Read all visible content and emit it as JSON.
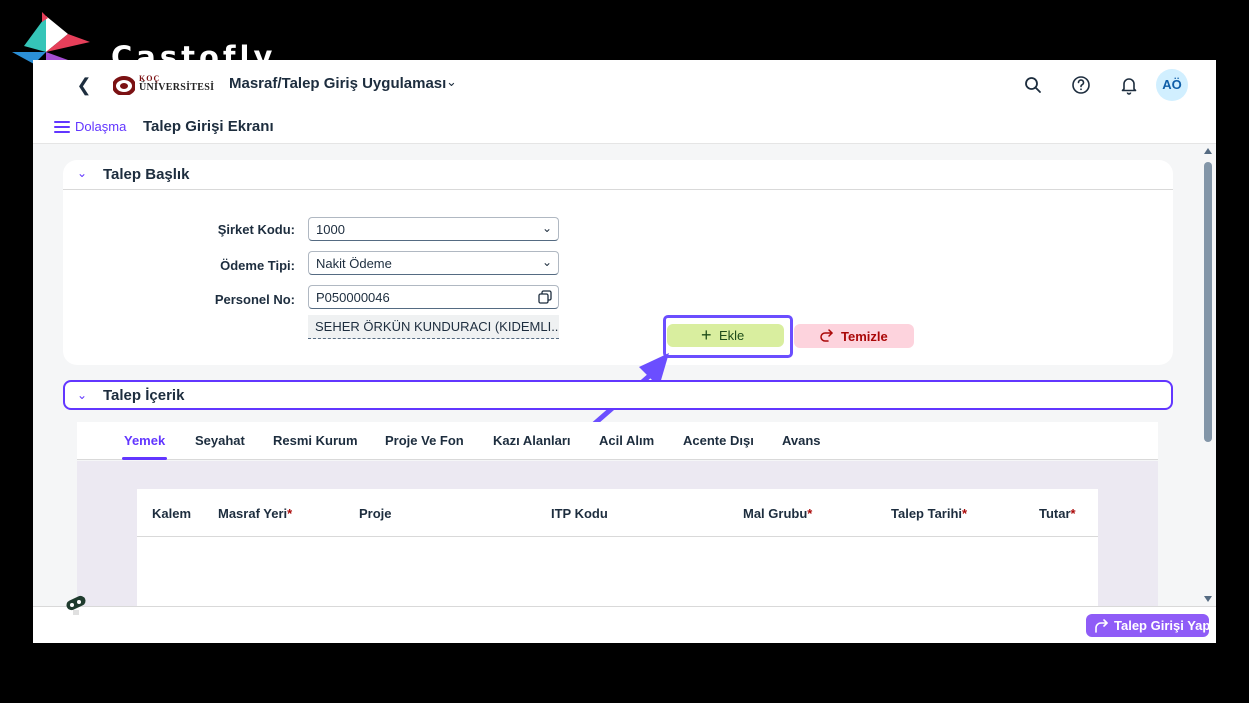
{
  "brand": {
    "name": "Castofly"
  },
  "shell": {
    "logo_line1": "KOÇ",
    "logo_line2": "ÜNİVERSİTESİ",
    "app_title": "Masraf/Talep Giriş Uygulaması",
    "avatar_initials": "AÖ",
    "icons": [
      "search-icon",
      "help-icon",
      "bell-icon"
    ]
  },
  "subheader": {
    "nav_label": "Dolaşma",
    "page_title": "Talep Girişi Ekranı"
  },
  "panel_header": {
    "title": "Talep Başlık",
    "fields": {
      "sirket_label": "Şirket Kodu:",
      "sirket_value": "1000",
      "odeme_label": "Ödeme Tipi:",
      "odeme_value": "Nakit Ödeme",
      "personel_label": "Personel No:",
      "personel_value": "P050000046",
      "personel_name": "SEHER ÖRKÜN KUNDURACI (KIDEMLI..."
    },
    "buttons": {
      "add_label": "Ekle",
      "clear_label": "Temizle"
    },
    "colors": {
      "highlight": "#6b4eff",
      "add_bg": "#d9ee9f",
      "clear_bg": "#fdd3dd"
    }
  },
  "panel_content": {
    "title": "Talep İçerik",
    "tabs": [
      {
        "label": "Yemek",
        "active": true
      },
      {
        "label": "Seyahat",
        "active": false
      },
      {
        "label": "Resmi Kurum",
        "active": false
      },
      {
        "label": "Proje Ve Fon",
        "active": false
      },
      {
        "label": "Kazı Alanları",
        "active": false
      },
      {
        "label": "Acil Alım",
        "active": false
      },
      {
        "label": "Acente Dışı",
        "active": false
      },
      {
        "label": "Avans",
        "active": false
      }
    ],
    "table": {
      "columns": [
        {
          "label": "Kalem",
          "required": false
        },
        {
          "label": "Masraf Yeri",
          "required": true
        },
        {
          "label": "Proje",
          "required": false
        },
        {
          "label": "ITP Kodu",
          "required": false
        },
        {
          "label": "Mal Grubu",
          "required": true
        },
        {
          "label": "Talep Tarihi",
          "required": true
        },
        {
          "label": "Tutar",
          "required": true
        }
      ],
      "required_marker": "*",
      "rows": []
    }
  },
  "footer": {
    "submit_label": "Talep Girişi Yap",
    "accent": "#8f5cf7"
  }
}
